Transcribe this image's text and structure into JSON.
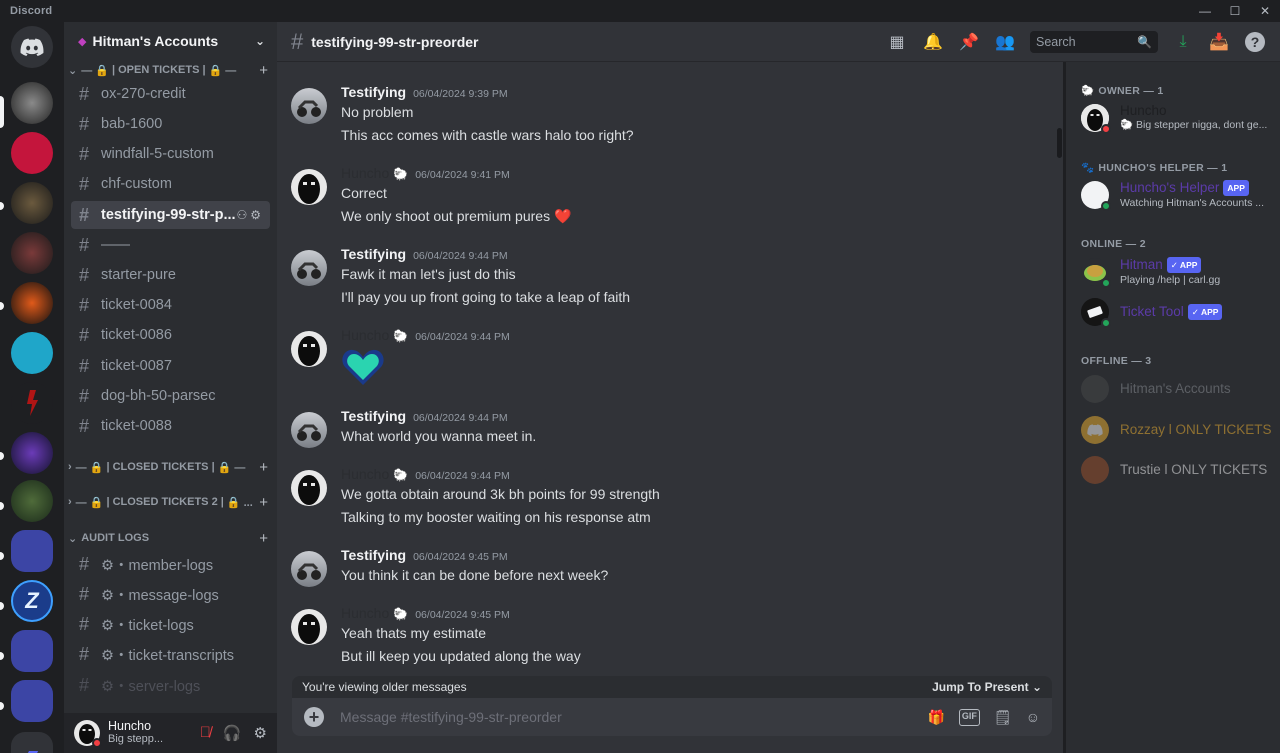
{
  "app": {
    "brand": "Discord"
  },
  "window": {
    "minimize": "—",
    "maximize": "☐",
    "close": "✕"
  },
  "guild": {
    "name": "Hitman's Accounts"
  },
  "categories": {
    "open": "| OPEN TICKETS |",
    "closed": "| CLOSED TICKETS |",
    "closed2": "| CLOSED TICKETS 2 |",
    "audit": "AUDIT LOGS"
  },
  "channels": [
    {
      "name": "ox-270-credit"
    },
    {
      "name": "bab-1600"
    },
    {
      "name": "windfall-5-custom"
    },
    {
      "name": "chf-custom"
    },
    {
      "name": "testifying-99-str-p..."
    },
    {
      "name": "——"
    },
    {
      "name": "starter-pure"
    },
    {
      "name": "ticket-0084"
    },
    {
      "name": "ticket-0086"
    },
    {
      "name": "ticket-0087"
    },
    {
      "name": "dog-bh-50-parsec"
    },
    {
      "name": "ticket-0088"
    }
  ],
  "audit_channels": [
    {
      "name": "⚙・member-logs"
    },
    {
      "name": "⚙・message-logs"
    },
    {
      "name": "⚙・ticket-logs"
    },
    {
      "name": "⚙・ticket-transcripts"
    },
    {
      "name": "⚙・server-logs"
    }
  ],
  "user": {
    "name": "Huncho",
    "status": "Big stepp..."
  },
  "topbar": {
    "channel": "testifying-99-str-preorder",
    "search_placeholder": "Search"
  },
  "messages": [
    {
      "author": "Testifying",
      "time": "06/04/2024 9:39 PM",
      "lines": [
        "No problem",
        "This acc comes with castle wars halo too right?"
      ]
    },
    {
      "author": "Huncho",
      "time": "06/04/2024 9:41 PM",
      "lines": [
        "Correct",
        "We only shoot out premium pures ❤️"
      ]
    },
    {
      "author": "Testifying",
      "time": "06/04/2024 9:44 PM",
      "lines": [
        "Fawk it man let's just do this",
        "I'll pay you up front going to take a leap of faith"
      ]
    },
    {
      "author": "Huncho",
      "time": "06/04/2024 9:44 PM",
      "lines": []
    },
    {
      "author": "Testifying",
      "time": "06/04/2024 9:44 PM",
      "lines": [
        "What world you wanna meet in."
      ]
    },
    {
      "author": "Huncho",
      "time": "06/04/2024 9:44 PM",
      "lines": [
        "We gotta obtain around 3k bh points for 99 strength",
        "Talking to my booster waiting on his response atm"
      ]
    },
    {
      "author": "Testifying",
      "time": "06/04/2024 9:45 PM",
      "lines": [
        "You think it can be done before next week?"
      ]
    },
    {
      "author": "Huncho",
      "time": "06/04/2024 9:45 PM",
      "lines": [
        "Yeah thats my estimate",
        "But ill keep you updated along the way"
      ]
    }
  ],
  "older_bar": {
    "text": "You're viewing older messages",
    "jump": "Jump To Present"
  },
  "composer": {
    "placeholder": "Message #testifying-99-str-preorder"
  },
  "member_groups": {
    "owner": "OWNER — 1",
    "helper": "HUNCHO'S HELPER — 1",
    "online": "ONLINE — 2",
    "offline": "OFFLINE — 3"
  },
  "members": {
    "huncho": {
      "name": "Huncho",
      "status": "Big stepper nigga, dont ge..."
    },
    "helper": {
      "name": "Huncho's Helper",
      "tag": "APP",
      "status": "Watching Hitman's Accounts ..."
    },
    "hitman": {
      "name": "Hitman",
      "tag": "✓ APP",
      "status": "Playing /help | carl.gg"
    },
    "tickettool": {
      "name": "Ticket Tool",
      "tag": "✓ APP"
    },
    "hitmans": {
      "name": "Hitman's Accounts"
    },
    "rozzay": {
      "name": "Rozzay l ONLY TICKETS"
    },
    "trustie": {
      "name": "Trustie l ONLY TICKETS"
    }
  },
  "colors": {
    "accent": "#5865f2",
    "online": "#23a55a",
    "dnd": "#f23f43",
    "app_purple": "#5b3ba8"
  }
}
